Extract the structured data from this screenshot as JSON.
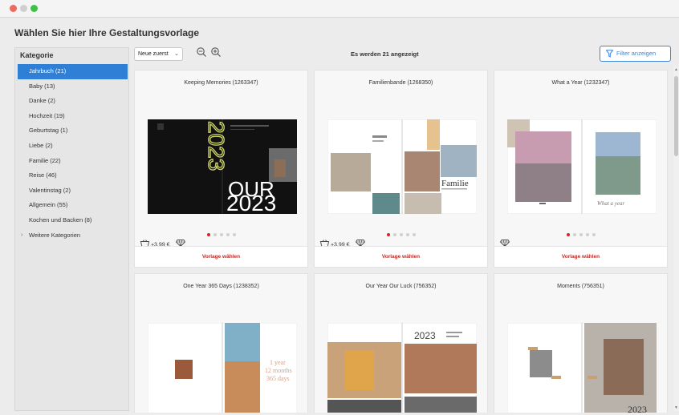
{
  "window": {
    "title": ""
  },
  "heading": "Wählen Sie hier Ihre Gestaltungsvorlage",
  "sidebar": {
    "title": "Kategorie",
    "items": [
      {
        "label": "Jahrbuch (21)",
        "active": true
      },
      {
        "label": "Baby (13)"
      },
      {
        "label": "Danke (2)"
      },
      {
        "label": "Hochzeit (19)"
      },
      {
        "label": "Geburtstag (1)"
      },
      {
        "label": "Liebe (2)"
      },
      {
        "label": "Familie (22)"
      },
      {
        "label": "Reise (46)"
      },
      {
        "label": "Valentinstag (2)"
      },
      {
        "label": "Allgemein (55)"
      },
      {
        "label": "Kochen und Backen (8)"
      }
    ],
    "more_label": "Weitere Kategorien"
  },
  "toolbar": {
    "sort_value": "Neue zuerst",
    "count_text": "Es werden 21 angezeigt",
    "filter_label": "Filter anzeigen"
  },
  "cards": [
    {
      "title": "Keeping Memories (1263347)",
      "price": "+3,99 €",
      "select": "Vorlage wählen",
      "dots": 5,
      "active_dot": 0
    },
    {
      "title": "Familienbande (1268350)",
      "price": "+3,99 €",
      "select": "Vorlage wählen",
      "dots": 5,
      "active_dot": 0
    },
    {
      "title": "What a Year (1232347)",
      "price": "",
      "select": "Vorlage wählen",
      "dots": 5,
      "active_dot": 0
    },
    {
      "title": "One Year 365 Days (1238352)"
    },
    {
      "title": "Our Year Our Luck (756352)"
    },
    {
      "title": "Moments (756351)"
    }
  ],
  "previews": {
    "card1": {
      "big_year": "2023",
      "our": "OUR",
      "year2": "2023"
    },
    "card2": {
      "word": "Familie"
    },
    "card3": {
      "caption": "What a year"
    },
    "card4": {
      "line1": "1 year",
      "line2": "12 months",
      "line3": "365 days"
    },
    "card5": {
      "year": "2023"
    },
    "card6": {
      "year": "2023"
    }
  },
  "colors": {
    "accent": "#2f7fd6",
    "link_red": "#c8261f",
    "dot_active": "#d8232a"
  }
}
